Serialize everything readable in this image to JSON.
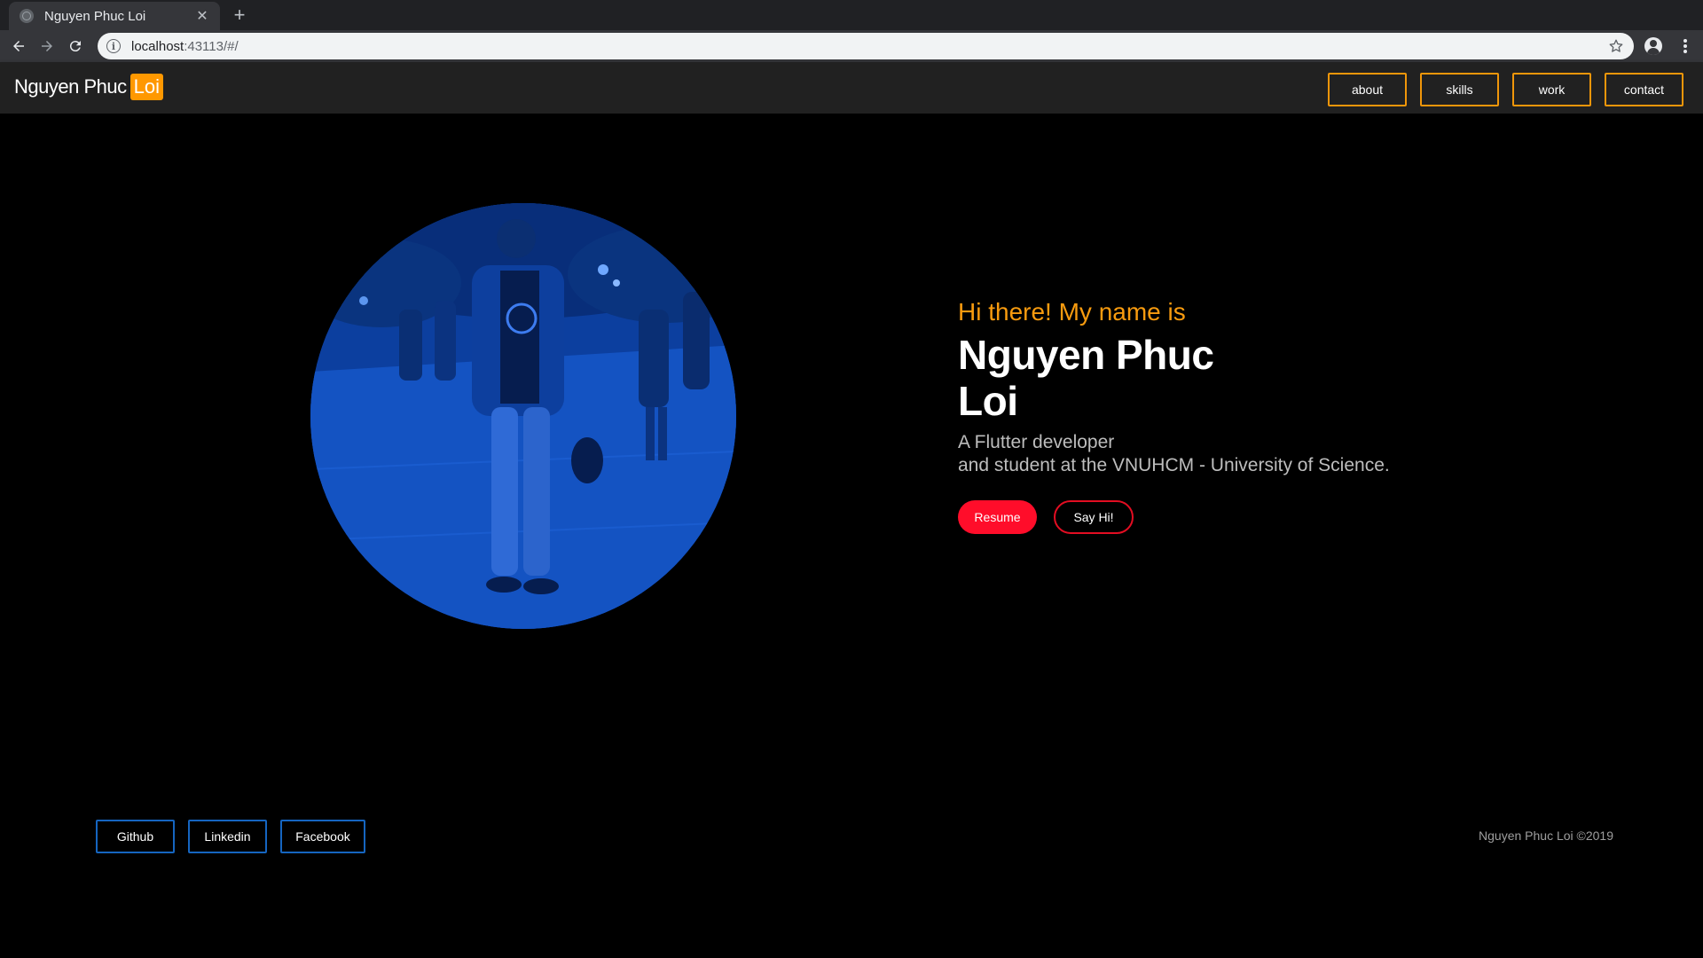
{
  "browser": {
    "tab_title": "Nguyen Phuc Loi",
    "url_host": "localhost",
    "url_rest": ":43113/#/"
  },
  "header": {
    "brand_first": "Nguyen Phuc",
    "brand_last": "Loi",
    "nav": [
      "about",
      "skills",
      "work",
      "contact"
    ]
  },
  "hero": {
    "greeting": "Hi there! My name is",
    "name_line1": "Nguyen Phuc",
    "name_line2": "Loi",
    "tagline_line1": "A Flutter developer",
    "tagline_line2": "and student at the VNUHCM - University of Science.",
    "resume_label": "Resume",
    "sayhi_label": "Say Hi!"
  },
  "footer": {
    "socials": [
      "Github",
      "Linkedin",
      "Facebook"
    ],
    "copyright": "Nguyen Phuc Loi ©2019"
  },
  "colors": {
    "accent_orange": "#f89b0f",
    "accent_red": "#ff0d2a",
    "social_border": "#1565c0",
    "photo_tint": "#0d45b0"
  }
}
